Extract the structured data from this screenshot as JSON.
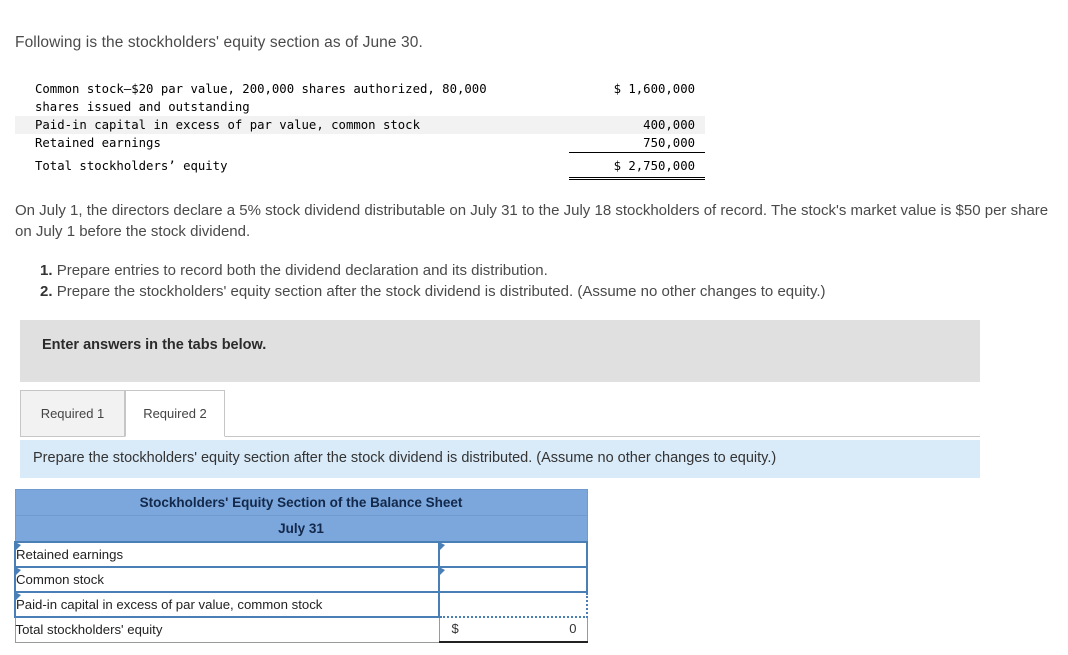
{
  "intro": {
    "text": "Following is the stockholders' equity section as of June 30."
  },
  "equity_statement": {
    "rows": [
      {
        "label": "Common stock–$20 par value, 200,000 shares authorized, 80,000\n  shares issued and outstanding",
        "value": "$ 1,600,000"
      },
      {
        "label": "Paid-in capital in excess of par value, common stock",
        "value": "400,000"
      },
      {
        "label": "Retained earnings",
        "value": "750,000"
      },
      {
        "label": "Total stockholders’ equity",
        "value": "$ 2,750,000"
      }
    ]
  },
  "problem": {
    "paragraph": "On July 1, the directors declare a 5% stock dividend distributable on July 31 to the July 18 stockholders of record. The stock's market value is $50 per share on July 1 before the stock dividend.",
    "requirements": [
      {
        "num": "1.",
        "text": "Prepare entries to record both the dividend declaration and its distribution."
      },
      {
        "num": "2.",
        "text": "Prepare the stockholders' equity section after the stock dividend is distributed. (Assume no other changes to equity.)"
      }
    ]
  },
  "instruction_band": {
    "text": "Enter answers in the tabs below."
  },
  "tabs": [
    {
      "label": "Required 1",
      "active": false
    },
    {
      "label": "Required 2",
      "active": true
    }
  ],
  "tab_instruction": {
    "text": "Prepare the stockholders' equity section after the stock dividend is distributed. (Assume no other changes to equity.)"
  },
  "answer_grid": {
    "title": "Stockholders' Equity Section of the Balance Sheet",
    "subtitle": "July 31",
    "rows": [
      {
        "label": "Retained earnings",
        "value": "",
        "style": "input"
      },
      {
        "label": "Common stock",
        "value": "",
        "style": "input"
      },
      {
        "label": "Paid-in capital in excess of par value, common stock",
        "value": "",
        "style": "input-dotted"
      },
      {
        "label": "Total stockholders' equity",
        "currency": "$",
        "value": "0",
        "style": "total"
      }
    ]
  },
  "colors": {
    "header_blue": "#7BA7DC",
    "band_blue": "#D9EAF8",
    "band_gray": "#E0E0E0",
    "cell_border_blue": "#4A7FB5"
  }
}
